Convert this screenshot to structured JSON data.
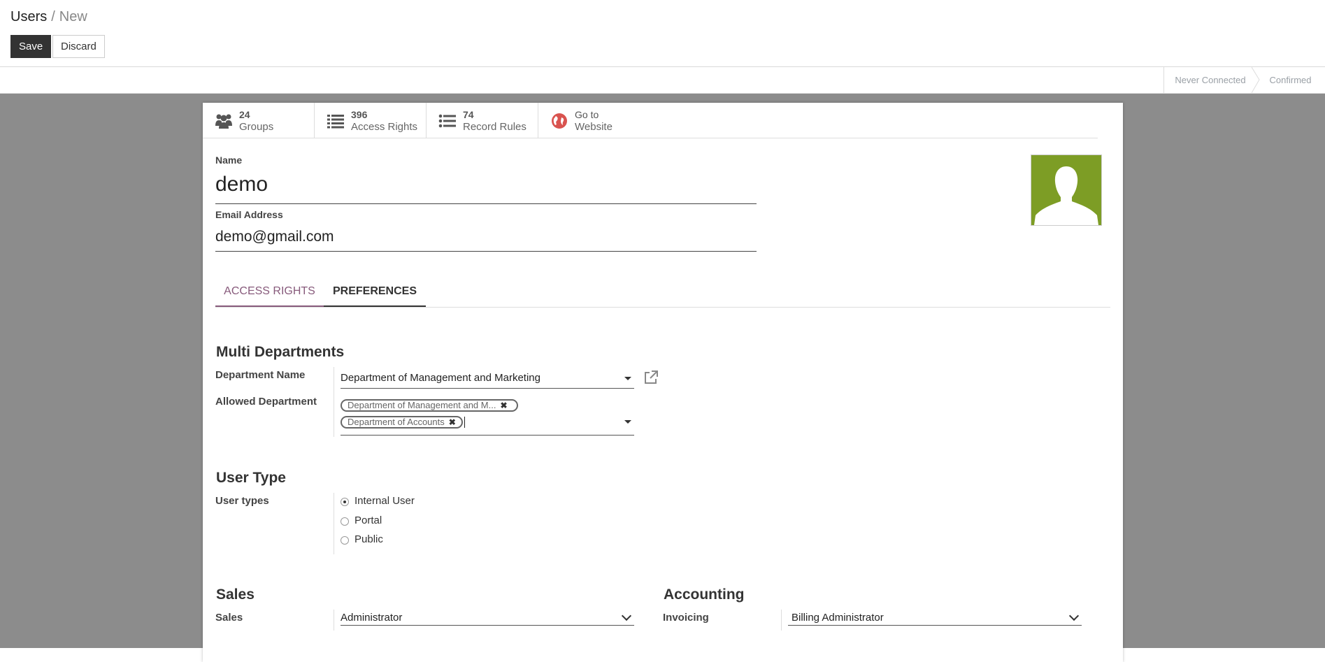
{
  "breadcrumb": {
    "parent": "Users",
    "separator": "/",
    "current": "New"
  },
  "toolbar": {
    "save_label": "Save",
    "discard_label": "Discard"
  },
  "statusbar": {
    "stages": [
      "Never Connected",
      "Confirmed"
    ]
  },
  "stat_buttons": [
    {
      "value": "24",
      "label": "Groups",
      "icon": "users-icon"
    },
    {
      "value": "396",
      "label": "Access Rights",
      "icon": "list-icon"
    },
    {
      "value": "74",
      "label": "Record Rules",
      "icon": "list-icon"
    },
    {
      "value": "Go to",
      "label": "Website",
      "icon": "globe-icon"
    }
  ],
  "form": {
    "name_label": "Name",
    "name_value": "demo",
    "email_label": "Email Address",
    "email_value": "demo@gmail.com"
  },
  "tabs": [
    {
      "label": "ACCESS RIGHTS"
    },
    {
      "label": "PREFERENCES"
    }
  ],
  "multi_departments": {
    "title": "Multi Departments",
    "department_label": "Department Name",
    "department_value": "Department of Management and Marketing",
    "allowed_label": "Allowed Department",
    "allowed_tags": [
      "Department of Management and M...",
      "Department of Accounts"
    ]
  },
  "user_type": {
    "title": "User Type",
    "label": "User types",
    "options": [
      "Internal User",
      "Portal",
      "Public"
    ],
    "selected": "Internal User"
  },
  "sales": {
    "title": "Sales",
    "label": "Sales",
    "value": "Administrator"
  },
  "accounting": {
    "title": "Accounting",
    "label": "Invoicing",
    "value": "Billing Administrator"
  },
  "colors": {
    "accent": "#875a7b",
    "avatar_bg": "#7d9d25",
    "globe": "#d9534f"
  }
}
